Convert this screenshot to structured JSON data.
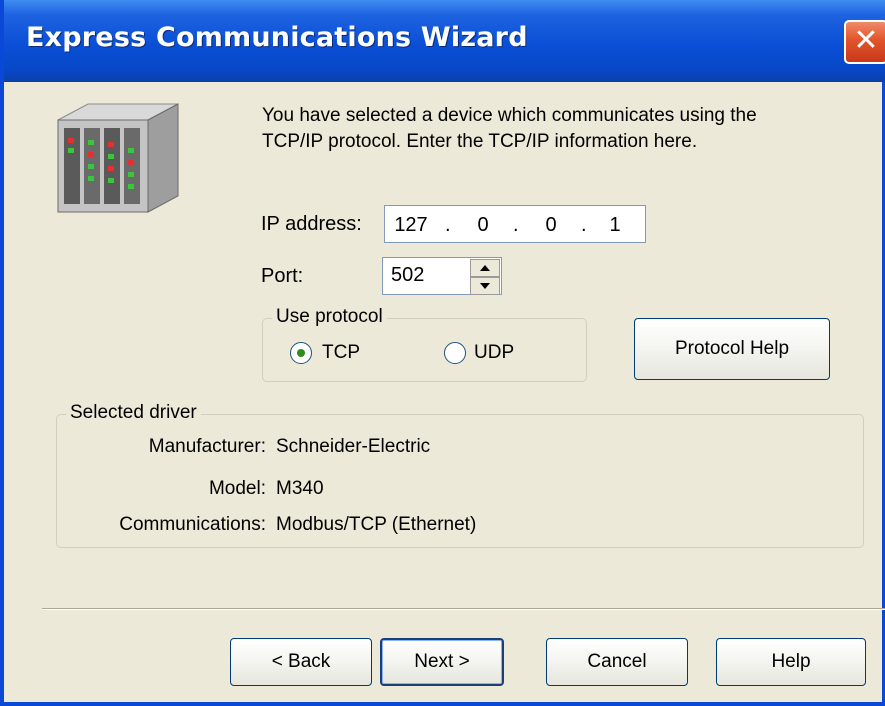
{
  "window": {
    "title": "Express Communications Wizard",
    "close_symbol": "✕"
  },
  "intro": {
    "line1": "You have selected a device which communicates using the",
    "line2": "TCP/IP protocol. Enter the TCP/IP information here."
  },
  "ip": {
    "label": "IP address:",
    "octets": [
      "127",
      "0",
      "0",
      "1"
    ],
    "separator": "."
  },
  "port": {
    "label": "Port:",
    "value": "502"
  },
  "protocol": {
    "legend": "Use protocol",
    "options": [
      {
        "label": "TCP",
        "selected": true
      },
      {
        "label": "UDP",
        "selected": false
      }
    ],
    "help_button": "Protocol Help"
  },
  "driver": {
    "legend": "Selected driver",
    "rows": [
      {
        "label": "Manufacturer:",
        "value": "Schneider-Electric"
      },
      {
        "label": "Model:",
        "value": "M340"
      },
      {
        "label": "Communications:",
        "value": "Modbus/TCP (Ethernet)"
      }
    ]
  },
  "buttons": {
    "back": "< Back",
    "next": "Next >",
    "cancel": "Cancel",
    "help": "Help"
  },
  "icons": {
    "device": "plc-device-icon",
    "close": "close-icon",
    "spin_up": "arrow-up-icon",
    "spin_down": "arrow-down-icon"
  },
  "colors": {
    "titlebar": "#0A4FD6",
    "dialog_bg": "#ECE9D8",
    "close_button": "#E2542C",
    "radio_dot": "#2E8B1E"
  }
}
